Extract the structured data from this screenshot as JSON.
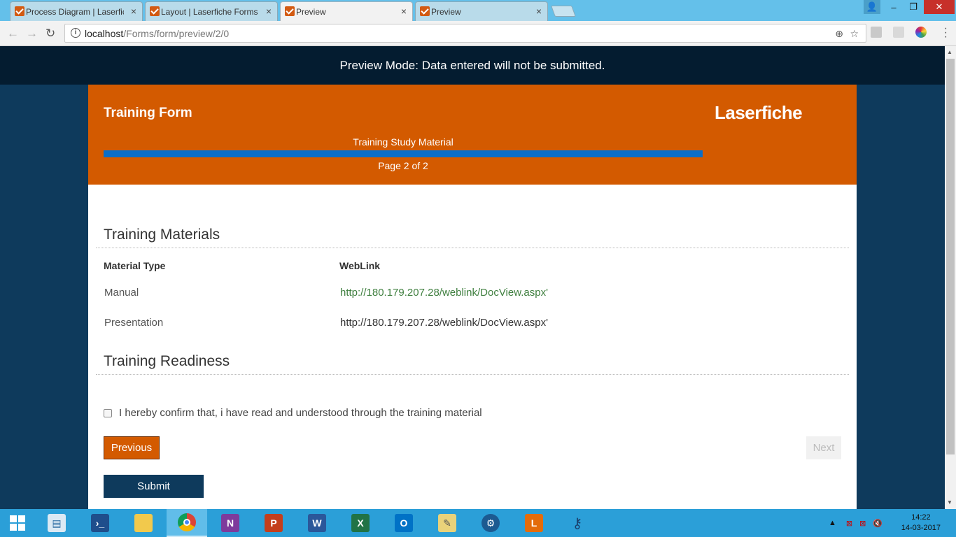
{
  "browser": {
    "tabs": [
      {
        "label": "Process Diagram | Laserfiche",
        "close": "×"
      },
      {
        "label": "Layout | Laserfiche Forms",
        "close": "×"
      },
      {
        "label": "Preview",
        "close": "×"
      },
      {
        "label": "Preview",
        "close": "×"
      }
    ],
    "address": {
      "host": "localhost",
      "path": "/Forms/form/preview/2/0"
    },
    "window_controls": {
      "minimize": "–",
      "maximize": "❐",
      "close": "✕"
    },
    "nav": {
      "back": "←",
      "forward": "→",
      "reload": "↻"
    }
  },
  "page": {
    "preview_banner": "Preview Mode: Data entered will not be submitted.",
    "form_title": "Training Form",
    "logo_text": "Laserfiche",
    "page_name": "Training Study Material",
    "page_indicator": "Page 2 of 2",
    "progress_fraction": 1.0
  },
  "training_materials": {
    "title": "Training Materials",
    "headers": {
      "type": "Material Type",
      "link": "WebLink"
    },
    "rows": [
      {
        "type": "Manual",
        "link": "http://180.179.207.28/weblink/DocView.aspx'"
      },
      {
        "type": "Presentation",
        "link": "http://180.179.207.28/weblink/DocView.aspx'"
      }
    ]
  },
  "training_readiness": {
    "title": "Training Readiness",
    "confirm_label": "I hereby confirm that, i have read and understood through the training material",
    "confirm_checked": false
  },
  "buttons": {
    "previous": "Previous",
    "next": "Next",
    "submit": "Submit"
  },
  "taskbar": {
    "apps": [
      "start",
      "file-explorer",
      "powershell",
      "folder",
      "chrome",
      "onenote",
      "powerpoint",
      "word",
      "excel",
      "outlook",
      "tools",
      "settings",
      "laserfiche",
      "key"
    ],
    "clock_time": "14:22",
    "clock_date": "14-03-2017"
  },
  "colors": {
    "accent_orange": "#d35a00",
    "navy": "#0e3a5c",
    "banner": "#041c30",
    "progress_blue": "#0a6ec8",
    "link_green": "#3f7f3f"
  }
}
